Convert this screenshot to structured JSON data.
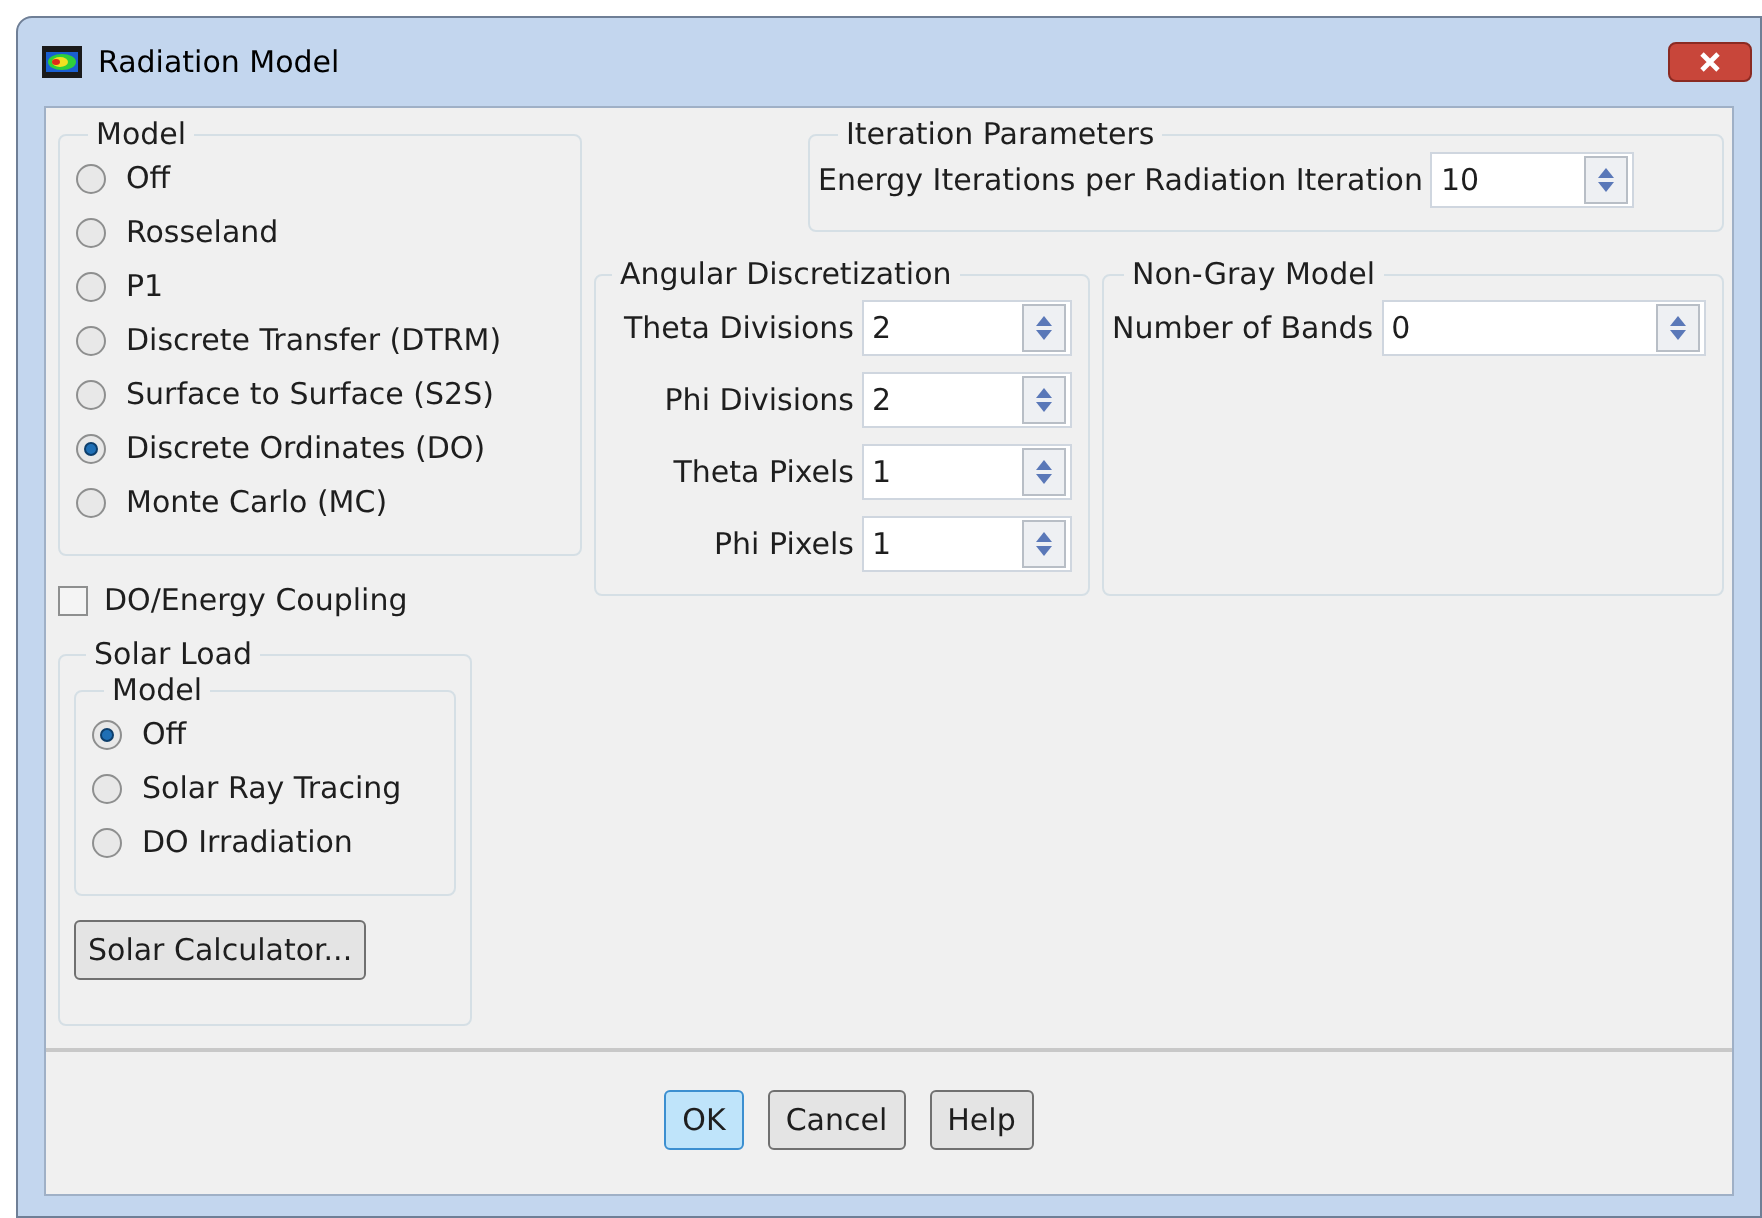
{
  "window": {
    "title": "Radiation Model"
  },
  "model": {
    "label": "Model",
    "options": [
      {
        "label": "Off",
        "selected": false
      },
      {
        "label": "Rosseland",
        "selected": false
      },
      {
        "label": "P1",
        "selected": false
      },
      {
        "label": "Discrete Transfer (DTRM)",
        "selected": false
      },
      {
        "label": "Surface to Surface (S2S)",
        "selected": false
      },
      {
        "label": "Discrete Ordinates (DO)",
        "selected": true
      },
      {
        "label": "Monte Carlo (MC)",
        "selected": false
      }
    ]
  },
  "do_energy_coupling": {
    "label": "DO/Energy Coupling",
    "checked": false
  },
  "solar_load": {
    "label": "Solar Load",
    "model": {
      "label": "Model",
      "options": [
        {
          "label": "Off",
          "selected": true
        },
        {
          "label": "Solar Ray Tracing",
          "selected": false
        },
        {
          "label": "DO Irradiation",
          "selected": false
        }
      ]
    },
    "button": "Solar Calculator..."
  },
  "iteration_parameters": {
    "label": "Iteration Parameters",
    "fields": [
      {
        "label": "Energy Iterations per Radiation Iteration",
        "value": "10"
      }
    ]
  },
  "angular_discretization": {
    "label": "Angular Discretization",
    "fields": [
      {
        "label": "Theta Divisions",
        "value": "2"
      },
      {
        "label": "Phi Divisions",
        "value": "2"
      },
      {
        "label": "Theta Pixels",
        "value": "1"
      },
      {
        "label": "Phi Pixels",
        "value": "1"
      }
    ]
  },
  "non_gray_model": {
    "label": "Non-Gray Model",
    "fields": [
      {
        "label": "Number of Bands",
        "value": "0"
      }
    ]
  },
  "buttons": [
    {
      "label": "OK",
      "default": true
    },
    {
      "label": "Cancel",
      "default": false
    },
    {
      "label": "Help",
      "default": false
    }
  ]
}
